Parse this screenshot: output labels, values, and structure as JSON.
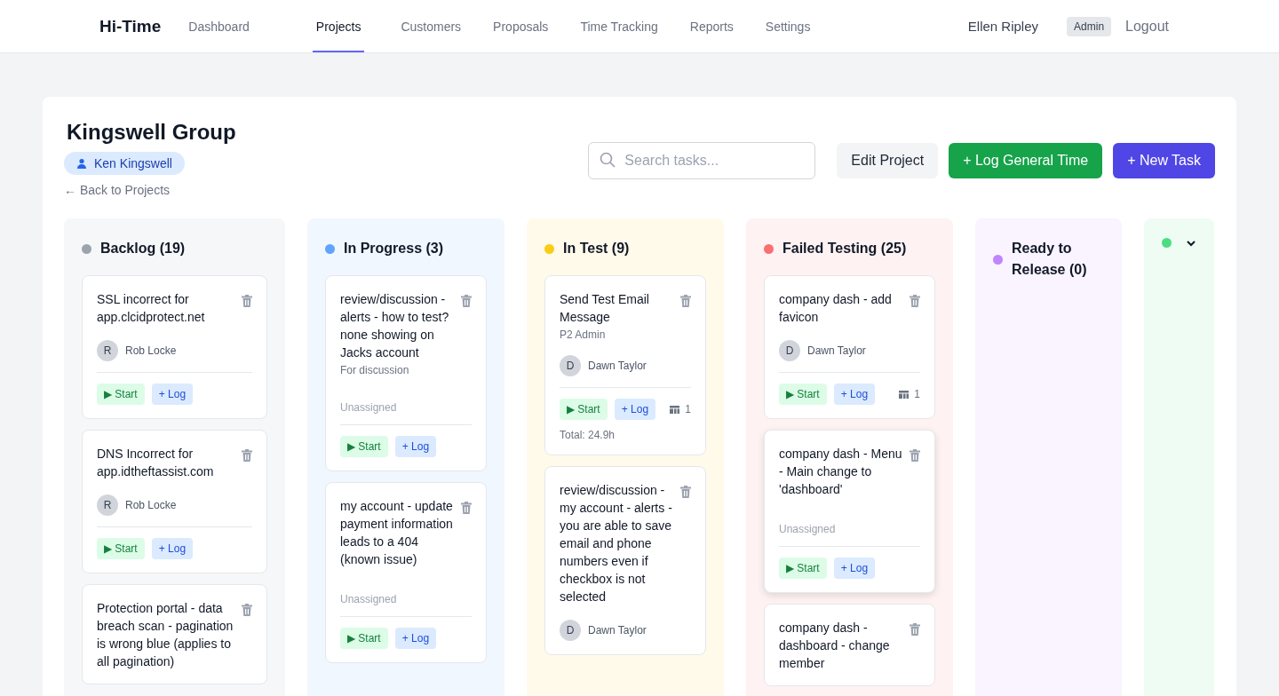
{
  "nav": {
    "logo": "Hi-Time",
    "items": [
      {
        "label": "Dashboard",
        "selected": false
      },
      {
        "label": "Projects",
        "selected": true
      },
      {
        "label": "Customers",
        "selected": false
      },
      {
        "label": "Proposals",
        "selected": false
      },
      {
        "label": "Time Tracking",
        "selected": false
      },
      {
        "label": "Reports",
        "selected": false
      },
      {
        "label": "Settings",
        "selected": false
      }
    ],
    "user": "Ellen Ripley",
    "role": "Admin",
    "logout": "Logout"
  },
  "project": {
    "title": "Kingswell Group",
    "customer": "Ken Kingswell",
    "back": "← Back to Projects"
  },
  "search": {
    "placeholder": "Search tasks..."
  },
  "buttons": [
    {
      "label": "Edit Project",
      "kind": "secondary"
    },
    {
      "label": "+ Log General Time",
      "kind": "success"
    },
    {
      "label": "+ New Task",
      "kind": "primary"
    }
  ],
  "columns": [
    {
      "title": "Backlog (19)",
      "color": "#9ca3af",
      "collapsed": false,
      "cards": [
        {
          "title": "SSL incorrect for app.clcidprotect.net",
          "assignee": {
            "initial": "R",
            "name": "Rob Locke"
          },
          "actions": [
            "▶ Start",
            "+ Log"
          ],
          "hovered": false
        },
        {
          "title": "DNS Incorrect for app.idtheftassist.com",
          "assignee": {
            "initial": "R",
            "name": "Rob Locke"
          },
          "actions": [
            "▶ Start",
            "+ Log"
          ],
          "hovered": false
        },
        {
          "title": "Protection portal - data breach scan - pagination is wrong blue (applies to all pagination)",
          "hovered": false
        }
      ]
    },
    {
      "title": "In Progress (3)",
      "color": "#60a5fa",
      "collapsed": false,
      "cards": [
        {
          "title": "review/discussion - alerts - how to test? none showing on Jacks account",
          "note": "For discussion",
          "unassigned": "Unassigned",
          "actions": [
            "▶ Start",
            "+ Log"
          ],
          "hovered": false
        },
        {
          "title": "my account - update payment information leads to a 404 (known issue)",
          "unassigned": "Unassigned",
          "actions": [
            "▶ Start",
            "+ Log"
          ],
          "hovered": false
        }
      ]
    },
    {
      "title": "In Test (9)",
      "color": "#facc15",
      "collapsed": false,
      "cards": [
        {
          "title": "Send Test Email Message",
          "note": "P2 Admin",
          "assignee": {
            "initial": "D",
            "name": "Dawn Taylor"
          },
          "actions": [
            "▶ Start",
            "+ Log"
          ],
          "count": "1",
          "total": "Total: 24.9h",
          "hovered": false
        },
        {
          "title": "review/discussion - my account - alerts - you are able to save email and phone numbers even if checkbox is not selected",
          "assignee": {
            "initial": "D",
            "name": "Dawn Taylor"
          },
          "hovered": false
        }
      ]
    },
    {
      "title": "Failed Testing (25)",
      "color": "#f87171",
      "collapsed": false,
      "cards": [
        {
          "title": "company dash - add favicon",
          "assignee": {
            "initial": "D",
            "name": "Dawn Taylor"
          },
          "actions": [
            "▶ Start",
            "+ Log"
          ],
          "count": "1",
          "hovered": false
        },
        {
          "title": "company dash - Menu - Main change to 'dashboard'",
          "unassigned": "Unassigned",
          "actions": [
            "▶ Start",
            "+ Log"
          ],
          "hovered": true
        },
        {
          "title": "company dash - dashboard - change member",
          "hovered": false
        }
      ]
    },
    {
      "title": "Ready to Release (0)",
      "color": "#c084fc",
      "collapsed": false
    },
    {
      "color": "#4ade80",
      "collapsed": true
    }
  ]
}
